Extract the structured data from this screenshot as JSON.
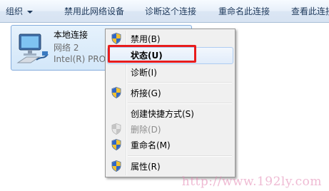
{
  "toolbar": {
    "organize": "组织",
    "disable_device": "禁用此网络设备",
    "diagnose": "诊断这个连接",
    "rename": "重命名此连接",
    "view_status": "查看此连接"
  },
  "connection": {
    "name": "本地连接",
    "network": "网络  2",
    "device": "Intel(R) PRO"
  },
  "context_menu": {
    "items": [
      {
        "label": "禁用(B)",
        "icon": "uac-shield-icon"
      },
      {
        "label": "状态(U)",
        "bold": true,
        "highlighted": true
      },
      {
        "label": "诊断(I)"
      },
      {
        "label": "桥接(G)",
        "icon": "uac-shield-icon"
      },
      {
        "label": "创建快捷方式(S)"
      },
      {
        "label": "删除(D)",
        "icon": "uac-shield-icon",
        "disabled": true
      },
      {
        "label": "重命名(M)",
        "icon": "uac-shield-icon"
      },
      {
        "label": "属性(R)",
        "icon": "uac-shield-icon"
      }
    ]
  },
  "watermark": "http://www.192ly.com",
  "colors": {
    "highlight_border": "#e81c1c",
    "selection": "#d3e7f9",
    "toolbar_text": "#1e395b"
  }
}
